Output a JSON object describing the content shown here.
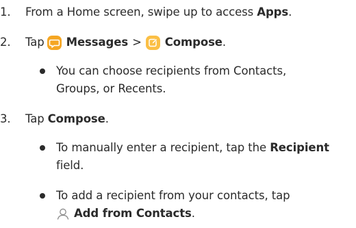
{
  "steps": [
    {
      "number": "1.",
      "text_before": "From a Home screen, swipe up to access ",
      "bold": "Apps",
      "text_after": "."
    },
    {
      "number": "2.",
      "tap": "Tap",
      "messages_label": "Messages",
      "separator": ">",
      "compose_label": "Compose",
      "end": ".",
      "bullet": {
        "line1": "You can choose recipients from Contacts,",
        "line2": "Groups, or Recents."
      }
    },
    {
      "number": "3.",
      "tap": "Tap",
      "compose_label": "Compose",
      "end": ".",
      "bullets": [
        {
          "line1_before": "To manually enter a recipient, tap the ",
          "line1_bold": "Recipient",
          "line2": "field."
        },
        {
          "line1": "To add a recipient from your contacts, tap",
          "line2_bold": "Add from Contacts",
          "line2_end": "."
        }
      ]
    }
  ],
  "icons": {
    "messages": "messages-icon",
    "compose": "compose-icon",
    "contacts": "person-icon"
  },
  "colors": {
    "text": "#2b2b2b",
    "icon_orange": "#f5a623",
    "icon_orange_light": "#fbbf45",
    "contact_icon": "#8a8a8a"
  }
}
